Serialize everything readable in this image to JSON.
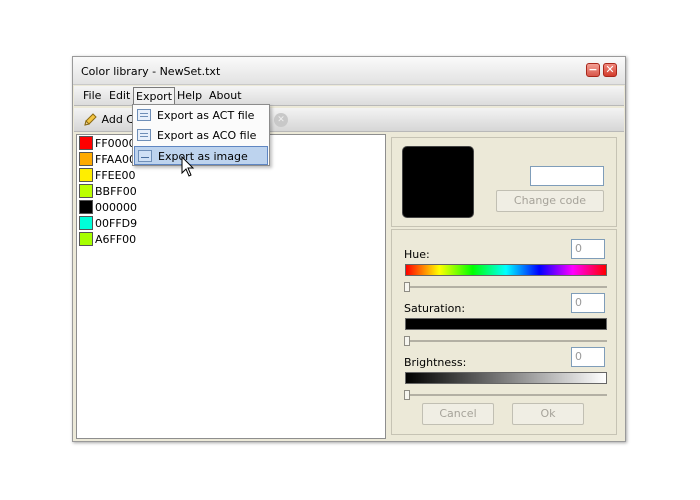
{
  "window": {
    "title": "Color library - NewSet.txt",
    "minimize_label": "−",
    "close_label": "✕"
  },
  "menubar": {
    "items": [
      "File",
      "Edit",
      "Export",
      "Help",
      "About"
    ]
  },
  "toolbar": {
    "add_label": "Add Co"
  },
  "colors": [
    {
      "hex": "FF0000",
      "color": "#FF0000"
    },
    {
      "hex": "FFAA00",
      "color": "#FFAA00"
    },
    {
      "hex": "FFEE00",
      "color": "#FFEE00"
    },
    {
      "hex": "BBFF00",
      "color": "#BBFF00"
    },
    {
      "hex": "000000",
      "color": "#000000"
    },
    {
      "hex": "00FFD9",
      "color": "#00FFD9"
    },
    {
      "hex": "A6FF00",
      "color": "#A6FF00"
    }
  ],
  "export_menu": {
    "items": [
      {
        "label": "Export as ACT file"
      },
      {
        "label": "Export as ACO file"
      },
      {
        "label": "Export as image"
      }
    ]
  },
  "editor": {
    "code_value": "",
    "change_code_label": "Change code",
    "hue_label": "Hue:",
    "hue_value": "0",
    "saturation_label": "Saturation:",
    "saturation_value": "0",
    "brightness_label": "Brightness:",
    "brightness_value": "0",
    "cancel_label": "Cancel",
    "ok_label": "Ok"
  }
}
